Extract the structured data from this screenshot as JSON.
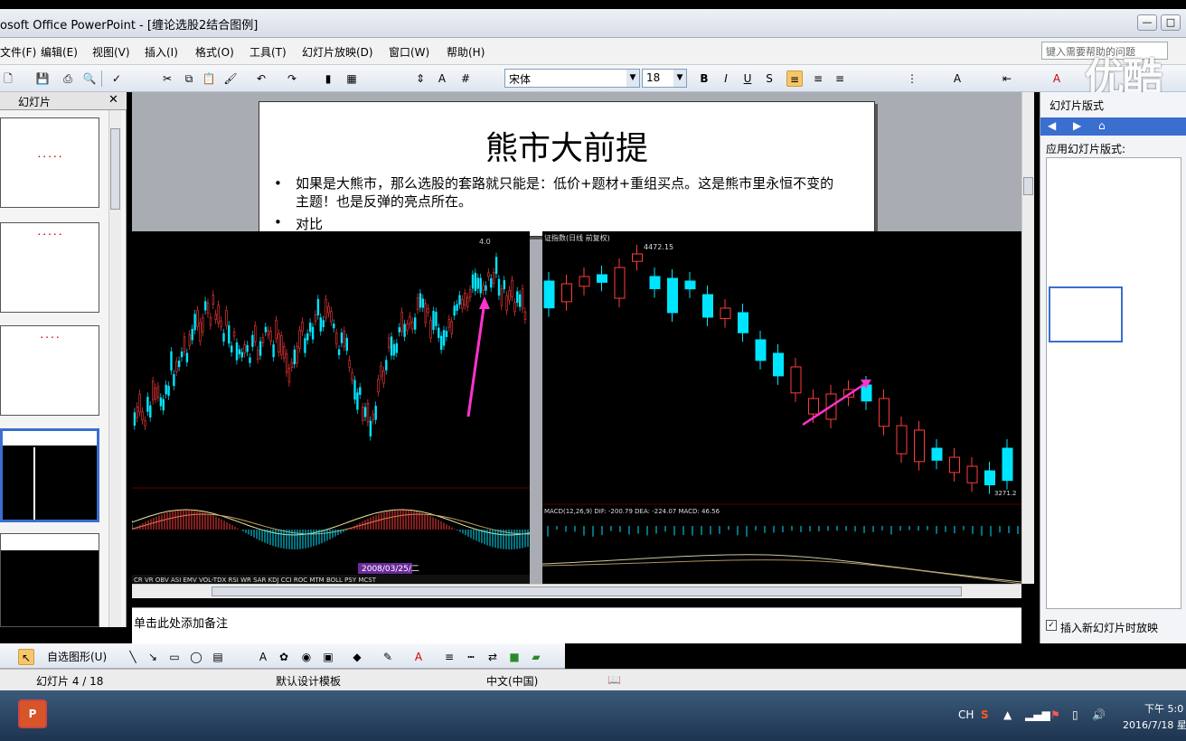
{
  "window": {
    "title": "osoft Office PowerPoint - [缠论选股2结合图例]"
  },
  "menu": [
    "文件(F)",
    "编辑(E)",
    "视图(V)",
    "插入(I)",
    "格式(O)",
    "工具(T)",
    "幻灯片放映(D)",
    "窗口(W)",
    "帮助(H)"
  ],
  "help_placeholder": "键入需要帮助的问题",
  "format": {
    "font": "宋体",
    "size": "18"
  },
  "left_pane": {
    "tab": "幻灯片"
  },
  "slide": {
    "title": "熊市大前提",
    "bullet1": "如果是大熊市，那么选股的套路就只能是：低价+题材+重组买点。这是熊市里永恒不变的主题！也是反弹的亮点所在。",
    "bullet2": "对比",
    "bullet_mark": "•"
  },
  "chart_left": {
    "date_label": "2008/03/25/二",
    "indicator_row": "CR  VR  OBV  ASI  EMV  VOL-TDX  RSI  WR  SAR  KDJ  CCI  ROC  MTM  BOLL  PSY  MCST",
    "peak_label": "4.0"
  },
  "chart_right": {
    "header": "证指数(日线 前复权)",
    "high_label": "4472.15",
    "low_label": "3271.2",
    "macd_label": "MACD(12,26,9)  DIF: -200.79  DEA: -224.07  MACD: 46.56"
  },
  "notes_placeholder": "单击此处添加备注",
  "right_pane": {
    "title": "幻灯片版式",
    "section": "应用幻灯片版式:",
    "checkbox": "插入新幻灯片时放映"
  },
  "draw_bar": {
    "autoshapes": "自选图形(U)"
  },
  "status": {
    "slide": "幻灯片 4 / 18",
    "template": "默认设计模板",
    "language": "中文(中国)"
  },
  "tray": {
    "lang": "CH",
    "time": "下午 5:0",
    "date": "2016/7/18 星"
  },
  "watermark": "优酷",
  "colors": {
    "up": "#ff3b3b",
    "down": "#00e5ff",
    "arrow": "#ff33cc"
  }
}
